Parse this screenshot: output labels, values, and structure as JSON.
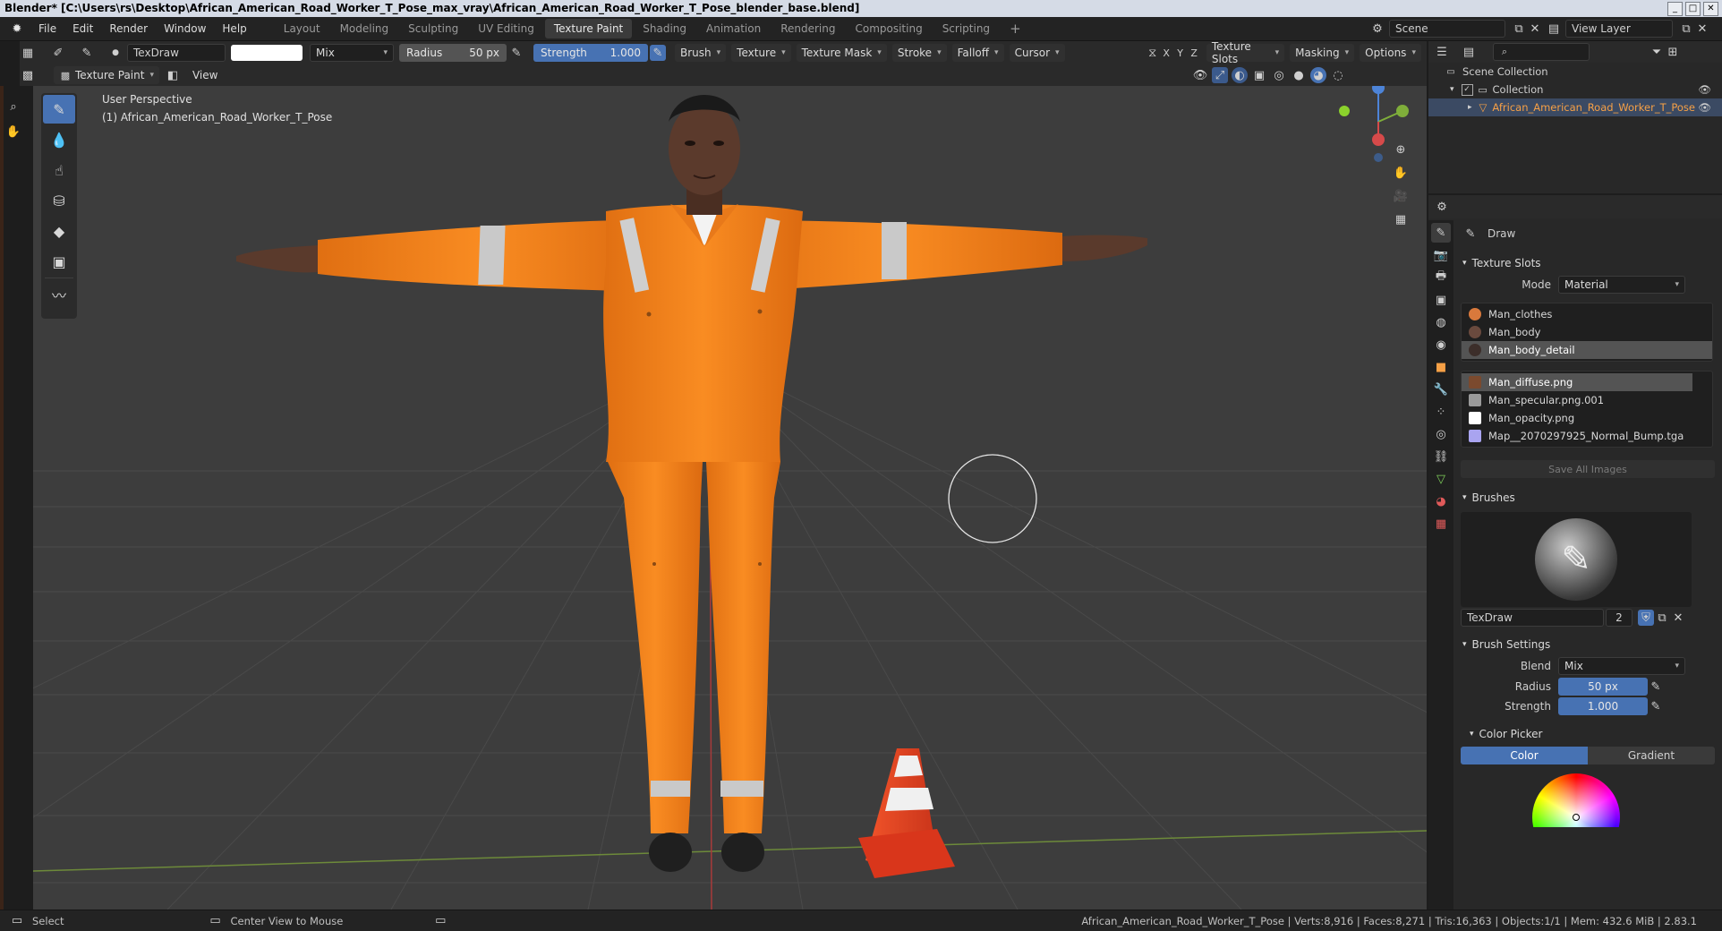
{
  "window": {
    "title": "Blender* [C:\\Users\\rs\\Desktop\\African_American_Road_Worker_T_Pose_max_vray\\African_American_Road_Worker_T_Pose_blender_base.blend]"
  },
  "menu": [
    "File",
    "Edit",
    "Render",
    "Window",
    "Help"
  ],
  "workspaces": [
    "Layout",
    "Modeling",
    "Sculpting",
    "UV Editing",
    "Texture Paint",
    "Shading",
    "Animation",
    "Rendering",
    "Compositing",
    "Scripting"
  ],
  "active_workspace": "Texture Paint",
  "scene": {
    "name": "Scene",
    "view_layer": "View Layer"
  },
  "toolbar": {
    "brush_name": "TexDraw",
    "blend": "Mix",
    "radius_label": "Radius",
    "radius_value": "50 px",
    "strength_label": "Strength",
    "strength_value": "1.000",
    "menus": [
      "Brush",
      "Texture",
      "Texture Mask",
      "Stroke",
      "Falloff",
      "Cursor"
    ],
    "axes": [
      "X",
      "Y",
      "Z"
    ],
    "right_menus": [
      "Texture Slots",
      "Masking",
      "Options"
    ]
  },
  "view_header": {
    "mode": "Texture Paint",
    "view": "View"
  },
  "viewport": {
    "perspective": "User Perspective",
    "object_label": "(1) African_American_Road_Worker_T_Pose"
  },
  "outliner": {
    "scene_collection": "Scene Collection",
    "collection": "Collection",
    "object": "African_American_Road_Worker_T_Pose"
  },
  "properties": {
    "tool_name": "Draw",
    "texture_slots": {
      "title": "Texture Slots",
      "mode_label": "Mode",
      "mode_value": "Material",
      "materials": [
        "Man_clothes",
        "Man_body",
        "Man_body_detail"
      ],
      "images": [
        "Man_diffuse.png",
        "Man_specular.png.001",
        "Man_opacity.png",
        "Map__2070297925_Normal_Bump.tga"
      ],
      "save_all": "Save All Images"
    },
    "brushes": {
      "title": "Brushes",
      "name": "TexDraw",
      "users": "2"
    },
    "brush_settings": {
      "title": "Brush Settings",
      "blend_label": "Blend",
      "blend_value": "Mix",
      "radius_label": "Radius",
      "radius_value": "50 px",
      "strength_label": "Strength",
      "strength_value": "1.000"
    },
    "color_picker": {
      "title": "Color Picker",
      "tab_color": "Color",
      "tab_gradient": "Gradient"
    }
  },
  "status": {
    "select": "Select",
    "center": "Center View to Mouse",
    "stats": "African_American_Road_Worker_T_Pose | Verts:8,916 | Faces:8,271 | Tris:16,363 | Objects:1/1 | Mem: 432.6 MiB | 2.83.1"
  },
  "colors": {
    "accent": "#4772b3",
    "suit": "#f7871f",
    "cone": "#e8401c",
    "viewport_bg": "#3d3d3d"
  }
}
